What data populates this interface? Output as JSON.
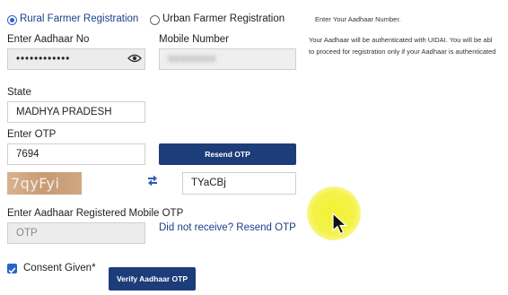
{
  "registration_type": {
    "rural_label": "Rural Farmer Registration",
    "urban_label": "Urban Farmer Registration",
    "selected": "rural"
  },
  "aadhaar": {
    "label": "Enter Aadhaar No",
    "value": "••••••••••••"
  },
  "mobile": {
    "label": "Mobile Number",
    "value": "XXXXXXXX"
  },
  "state": {
    "label": "State",
    "value": "MADHYA PRADESH"
  },
  "otp": {
    "label": "Enter OTP",
    "value": "7694",
    "resend_button": "Resend OTP"
  },
  "captcha": {
    "image_text": "7qyFyi",
    "input_value": "TYaCBj"
  },
  "aadhaar_otp": {
    "label": "Enter Aadhaar Registered Mobile OTP",
    "placeholder": "OTP",
    "resend_link": "Did not receive? Resend OTP"
  },
  "consent": {
    "label": "Consent Given*",
    "checked": true
  },
  "verify_button": "Verify Aadhaar OTP",
  "info_panel": {
    "title": "Enter Your Aadhaar Number.",
    "line1": "Your Aadhaar will be authenticated with UIDAI. You will be abl",
    "line2": "to proceed for registration only if your Aadhaar is authenticated"
  },
  "icons": {
    "eye": "eye-icon",
    "refresh": "refresh-icon",
    "cursor": "mouse-pointer-icon"
  },
  "colors": {
    "primary_button": "#1d3c7a",
    "link": "#1a3f8a",
    "radio_selected": "#2a63c9",
    "captcha_bg": "#c79b74",
    "cursor_highlight": "#f3f028"
  }
}
